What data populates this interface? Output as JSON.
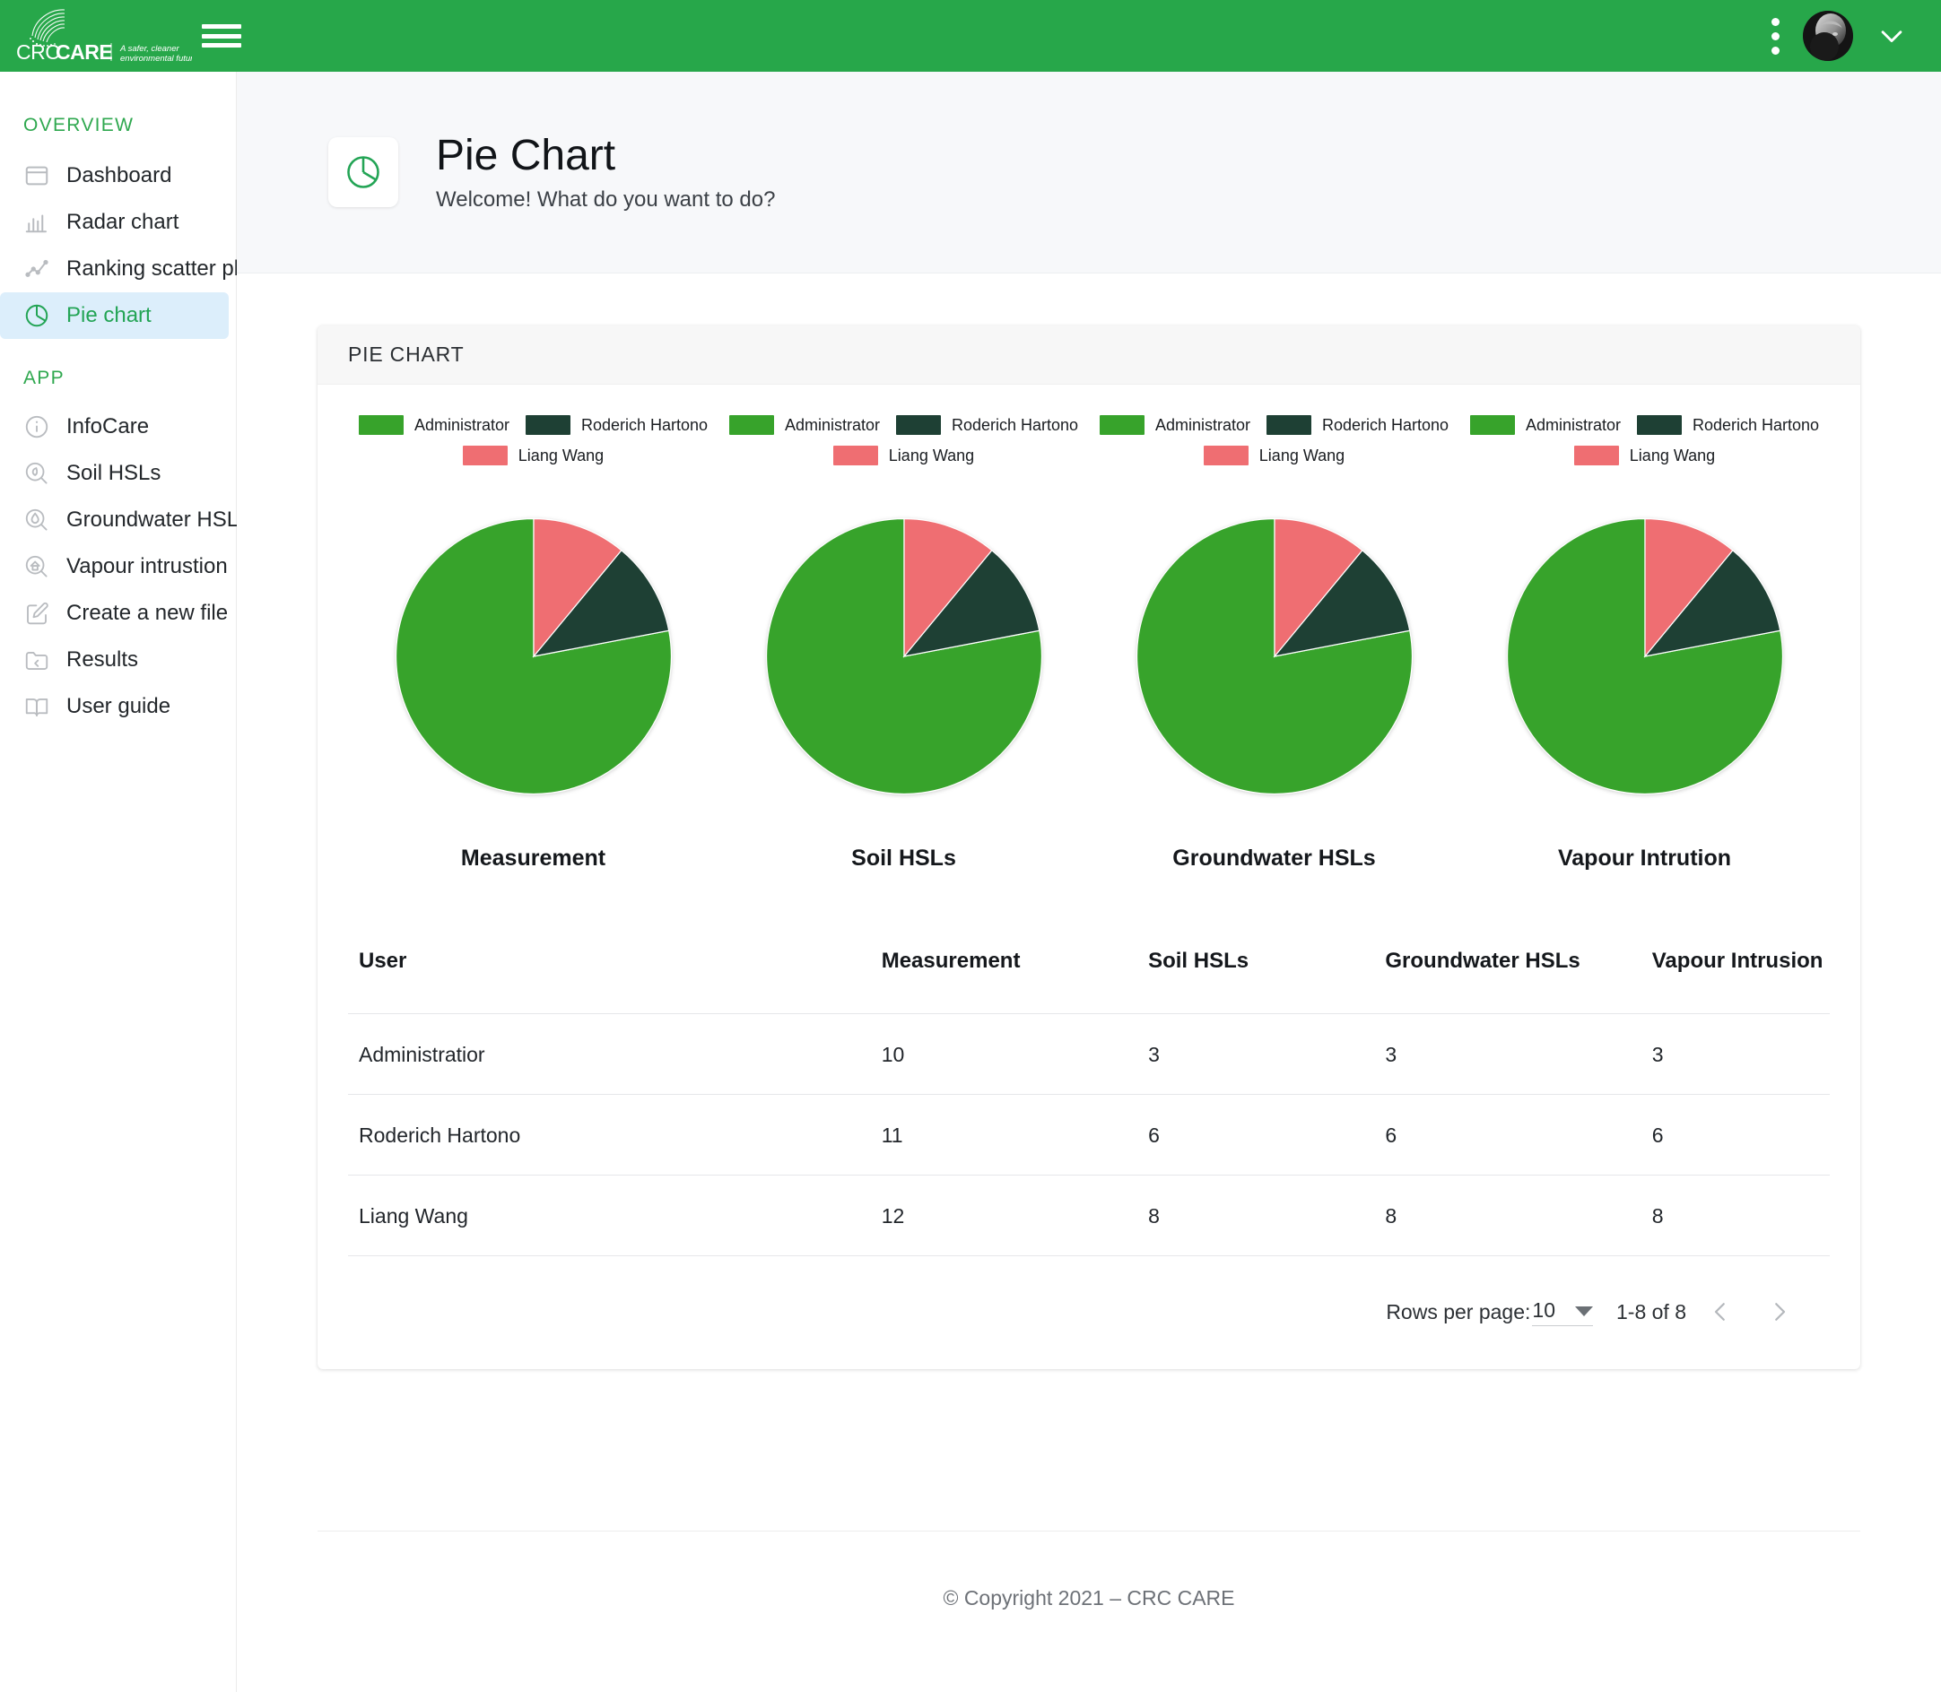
{
  "brand": {
    "name_light": "CRC",
    "name_bold": "CARE",
    "tagline_line1": "A safer, cleaner",
    "tagline_line2": "environmental future",
    "header_color": "#27a74a"
  },
  "topbar": {
    "menu_icon": "hamburger-icon",
    "more_icon": "more-vertical-icon",
    "avatar_alt": "user-avatar",
    "expand_icon": "chevron-down-icon"
  },
  "sidebar": {
    "sections": [
      {
        "title": "OVERVIEW",
        "items": [
          {
            "label": "Dashboard",
            "icon": "dashboard-icon",
            "active": false
          },
          {
            "label": "Radar chart",
            "icon": "bar-chart-icon",
            "active": false
          },
          {
            "label": "Ranking scatter plot",
            "icon": "line-chart-icon",
            "active": false
          },
          {
            "label": "Pie chart",
            "icon": "pie-chart-icon",
            "active": true
          }
        ]
      },
      {
        "title": "APP",
        "items": [
          {
            "label": "InfoCare",
            "icon": "info-icon",
            "active": false
          },
          {
            "label": "Soil HSLs",
            "icon": "soil-search-icon",
            "active": false
          },
          {
            "label": "Groundwater HSLs",
            "icon": "water-search-icon",
            "active": false
          },
          {
            "label": "Vapour intrustion",
            "icon": "house-search-icon",
            "active": false
          },
          {
            "label": "Create a new file",
            "icon": "edit-file-icon",
            "active": false
          },
          {
            "label": "Results",
            "icon": "folder-icon",
            "active": false
          },
          {
            "label": "User guide",
            "icon": "book-icon",
            "active": false
          }
        ]
      }
    ],
    "active_bg": "#dceefb",
    "active_color": "#23a455"
  },
  "page": {
    "icon": "pie-chart-icon",
    "title": "Pie Chart",
    "subtitle": "Welcome! What do you want to do?"
  },
  "card": {
    "title": "PIE CHART"
  },
  "chart_data": {
    "type": "pie",
    "title": "PIE CHART",
    "legend_position": "top",
    "legend": [
      {
        "name": "Administrator",
        "color": "#37a32b"
      },
      {
        "name": "Roderich Hartono",
        "color": "#1e4034"
      },
      {
        "name": "Liang Wang",
        "color": "#ef6e72"
      }
    ],
    "charts": [
      {
        "title": "Measurement",
        "categories": [
          "Administrator",
          "Roderich Hartono",
          "Liang Wang"
        ],
        "values": [
          78,
          11,
          11
        ]
      },
      {
        "title": "Soil HSLs",
        "categories": [
          "Administrator",
          "Roderich Hartono",
          "Liang Wang"
        ],
        "values": [
          78,
          11,
          11
        ]
      },
      {
        "title": "Groundwater HSLs",
        "categories": [
          "Administrator",
          "Roderich Hartono",
          "Liang Wang"
        ],
        "values": [
          78,
          11,
          11
        ]
      },
      {
        "title": "Vapour Intrution",
        "categories": [
          "Administrator",
          "Roderich Hartono",
          "Liang Wang"
        ],
        "values": [
          78,
          11,
          11
        ]
      }
    ]
  },
  "table": {
    "columns": [
      "User",
      "Measurement",
      "Soil HSLs",
      "Groundwater HSLs",
      "Vapour Intrusion"
    ],
    "rows": [
      {
        "user": "Administratior",
        "measurement": "10",
        "soil": "3",
        "groundwater": "3",
        "vapour": "3"
      },
      {
        "user": "Roderich Hartono",
        "measurement": "11",
        "soil": "6",
        "groundwater": "6",
        "vapour": "6"
      },
      {
        "user": "Liang Wang",
        "measurement": "12",
        "soil": "8",
        "groundwater": "8",
        "vapour": "8"
      }
    ]
  },
  "pagination": {
    "rows_per_page_label": "Rows per page:",
    "rows_per_page_value": "10",
    "range": "1-8 of 8",
    "prev_icon": "chevron-left-icon",
    "next_icon": "chevron-right-icon"
  },
  "footer": {
    "text": "© Copyright 2021 – CRC CARE"
  }
}
